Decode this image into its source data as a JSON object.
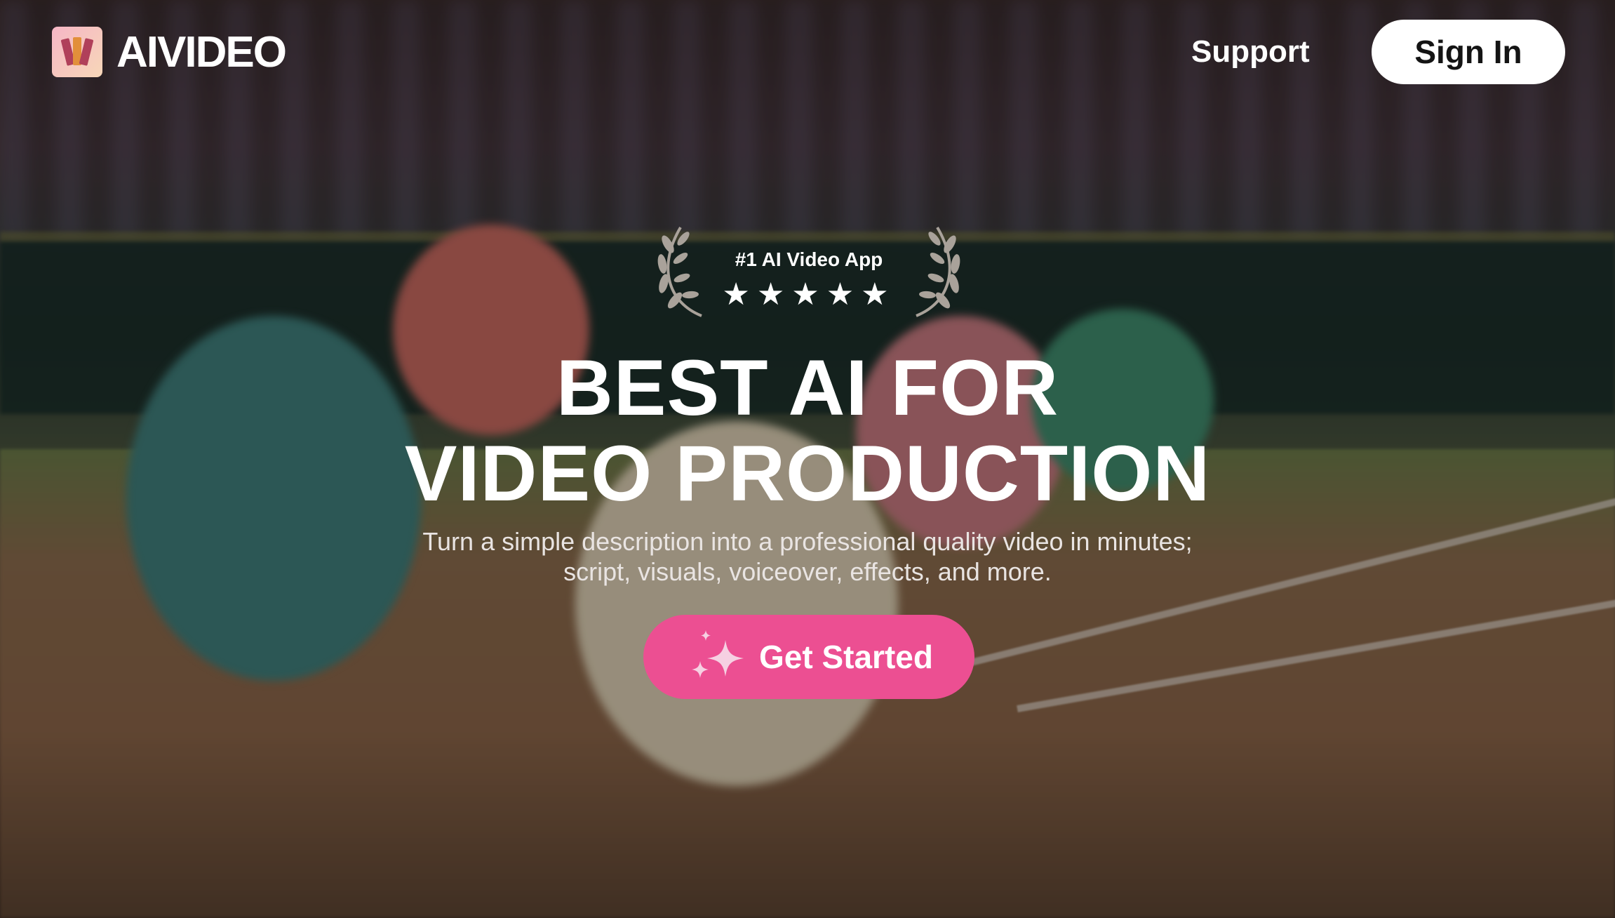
{
  "brand": {
    "name": "AIVIDEO",
    "logo_icon": "film-strip-logo-icon"
  },
  "nav": {
    "support_label": "Support",
    "signin_label": "Sign In"
  },
  "award": {
    "text": "#1 AI Video App",
    "stars": "★★★★★",
    "rating": 5
  },
  "hero": {
    "headline_line1": "BEST AI FOR",
    "headline_line2": "VIDEO PRODUCTION",
    "subhead": "Turn a simple description into a professional quality video in minutes; script, visuals, voiceover, effects, and more.",
    "cta_label": "Get Started",
    "cta_icon": "sparkle-icon"
  },
  "colors": {
    "cta": "#ec4f92",
    "signin_bg": "#ffffff",
    "text": "#ffffff"
  }
}
